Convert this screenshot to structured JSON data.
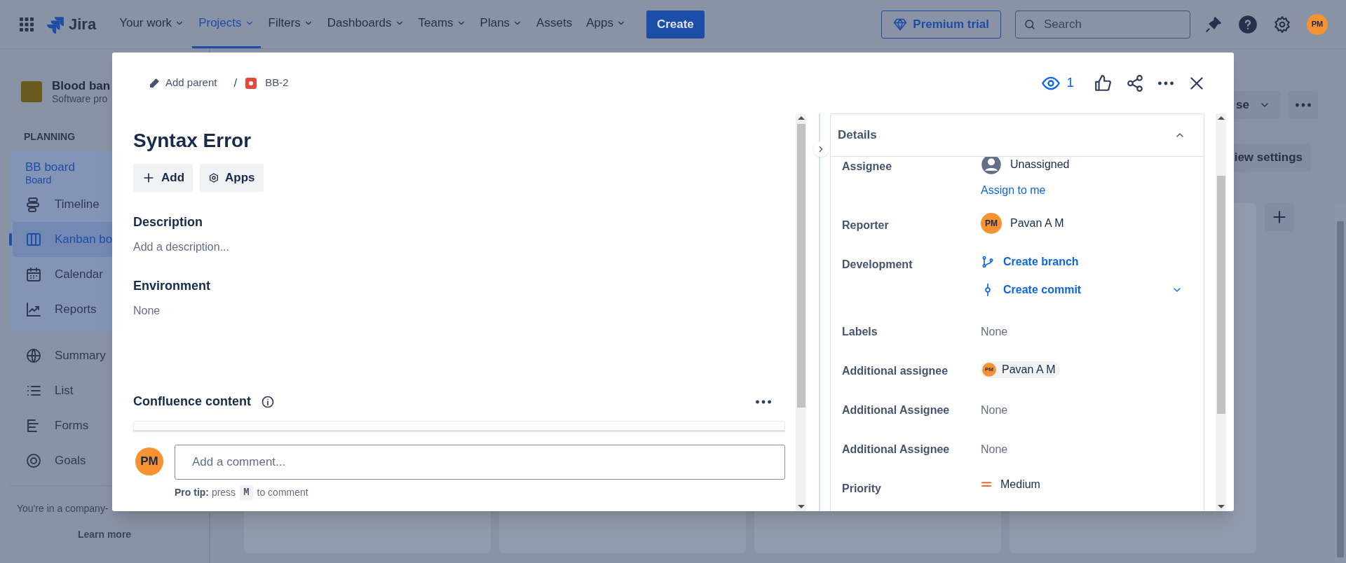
{
  "topnav": {
    "product": "Jira",
    "items": [
      {
        "label": "Your work",
        "dropdown": true,
        "selected": false
      },
      {
        "label": "Projects",
        "dropdown": true,
        "selected": true
      },
      {
        "label": "Filters",
        "dropdown": true,
        "selected": false
      },
      {
        "label": "Dashboards",
        "dropdown": true,
        "selected": false
      },
      {
        "label": "Teams",
        "dropdown": true,
        "selected": false
      },
      {
        "label": "Plans",
        "dropdown": true,
        "selected": false
      },
      {
        "label": "Assets",
        "dropdown": false,
        "selected": false
      },
      {
        "label": "Apps",
        "dropdown": true,
        "selected": false
      }
    ],
    "create": "Create",
    "premium": "Premium trial",
    "search": {
      "placeholder": "Search"
    },
    "avatar": "PM"
  },
  "sidebar": {
    "project": {
      "name": "Blood ban",
      "type": "Software pro"
    },
    "section": "PLANNING",
    "board": {
      "name": "BB board",
      "type": "Board"
    },
    "board_items": [
      {
        "label": "Timeline",
        "kind": "timeline",
        "selected": false
      },
      {
        "label": "Kanban bo",
        "kind": "columns",
        "selected": true
      },
      {
        "label": "Calendar",
        "kind": "calendar",
        "selected": false
      },
      {
        "label": "Reports",
        "kind": "chart",
        "selected": false
      }
    ],
    "items": [
      {
        "label": "Summary",
        "kind": "globe"
      },
      {
        "label": "List",
        "kind": "list"
      },
      {
        "label": "Forms",
        "kind": "forms"
      },
      {
        "label": "Goals",
        "kind": "target"
      }
    ],
    "notice": "You're in a company-",
    "link": "Learn more"
  },
  "board": {
    "group_button": "se",
    "view_settings": "iew settings"
  },
  "modal": {
    "breadcrumb": {
      "parent": "Add parent",
      "separator": "/",
      "key": "BB-2"
    },
    "watchers": "1",
    "title": "Syntax Error",
    "actions": [
      {
        "label": "Add",
        "kind": "plus"
      },
      {
        "label": "Apps",
        "kind": "apps"
      }
    ],
    "sections": [
      {
        "heading": "Description",
        "text": "Add a description..."
      },
      {
        "heading": "Environment",
        "text": "None"
      }
    ],
    "confluence": "Confluence content",
    "comment": {
      "avatar": "PM",
      "placeholder": "Add a comment...",
      "tip": "**Pro tip:** press",
      "key": "M",
      "tip_after": "to comment"
    },
    "details": {
      "heading": "Details",
      "expanded": true,
      "fields": [
        {
          "label": "Assignee",
          "kind": "assignee",
          "value": "Unassigned",
          "action": "Assign to me"
        },
        {
          "label": "Reporter",
          "kind": "person",
          "value": "Pavan A M",
          "avatar": "PM"
        },
        {
          "label": "Development",
          "kind": "development",
          "links": [
            {
              "label": "Create branch",
              "kind": "branch"
            },
            {
              "label": "Create commit",
              "kind": "commit"
            }
          ]
        },
        {
          "label": "Labels",
          "kind": "empty",
          "value": "None"
        },
        {
          "label": "Additional assignee",
          "kind": "chip",
          "value": "Pavan A M",
          "avatar": "PM"
        },
        {
          "label": "Additional Assignee",
          "kind": "empty",
          "value": "None"
        },
        {
          "label": "Additional Assignee",
          "kind": "empty",
          "value": "None"
        },
        {
          "label": "Priority",
          "kind": "priority",
          "value": "Medium"
        }
      ]
    }
  }
}
